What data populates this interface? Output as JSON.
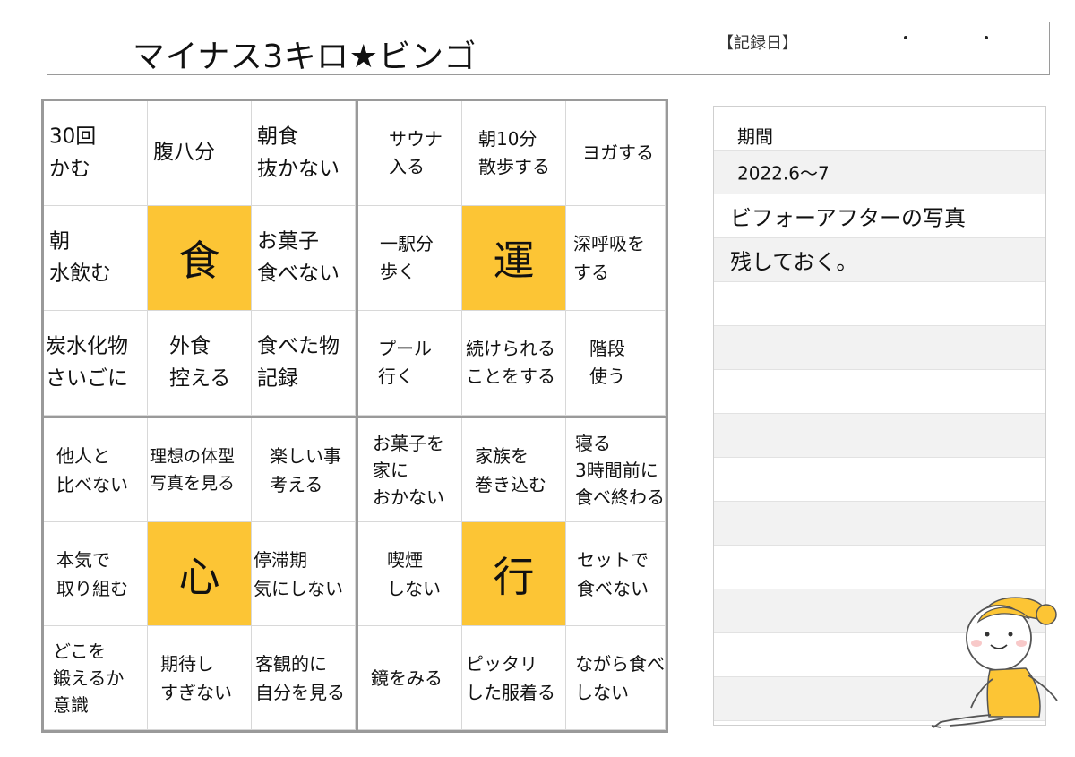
{
  "header": {
    "title": "マイナス3キロ★ビンゴ",
    "record_label": "【記録日】"
  },
  "bingo": {
    "q1": {
      "r0": [
        "30回\nかむ",
        "腹八分",
        "朝食\n抜かない"
      ],
      "r1": [
        "朝\n水飲む",
        "食",
        "お菓子\n食べない"
      ],
      "r2": [
        "炭水化物\nさいごに",
        "外食\n控える",
        "食べた物\n記録"
      ]
    },
    "q2": {
      "r0": [
        "サウナ\n入る",
        "朝10分\n散歩する",
        "ヨガする"
      ],
      "r1": [
        "一駅分\n歩く",
        "運",
        "深呼吸を\nする"
      ],
      "r2": [
        "プール\n行く",
        "続けられる\nことをする",
        "階段\n使う"
      ]
    },
    "q3": {
      "r0": [
        "他人と\n比べない",
        "理想の体型\n写真を見る",
        "楽しい事\n考える"
      ],
      "r1": [
        "本気で\n取り組む",
        "心",
        "停滞期\n気にしない"
      ],
      "r2": [
        "どこを\n鍛えるか\n意識",
        "期待し\nすぎない",
        "客観的に\n自分を見る"
      ]
    },
    "q4": {
      "r0": [
        "お菓子を\n家に\nおかない",
        "家族を\n巻き込む",
        "寝る\n3時間前に\n食べ終わる"
      ],
      "r1": [
        "喫煙\nしない",
        "行",
        "セットで\n食べない"
      ],
      "r2": [
        "鏡をみる",
        "ピッタリ\nした服着る",
        "ながら食べ\nしない"
      ]
    }
  },
  "panel": {
    "period_label": "期間",
    "period_value": "2022.6〜7",
    "note_line1": "ビフォーアフターの写真",
    "note_line2": "残しておく。"
  },
  "colors": {
    "center_fill": "#fcc535",
    "grid_border": "#9a9a9a"
  }
}
